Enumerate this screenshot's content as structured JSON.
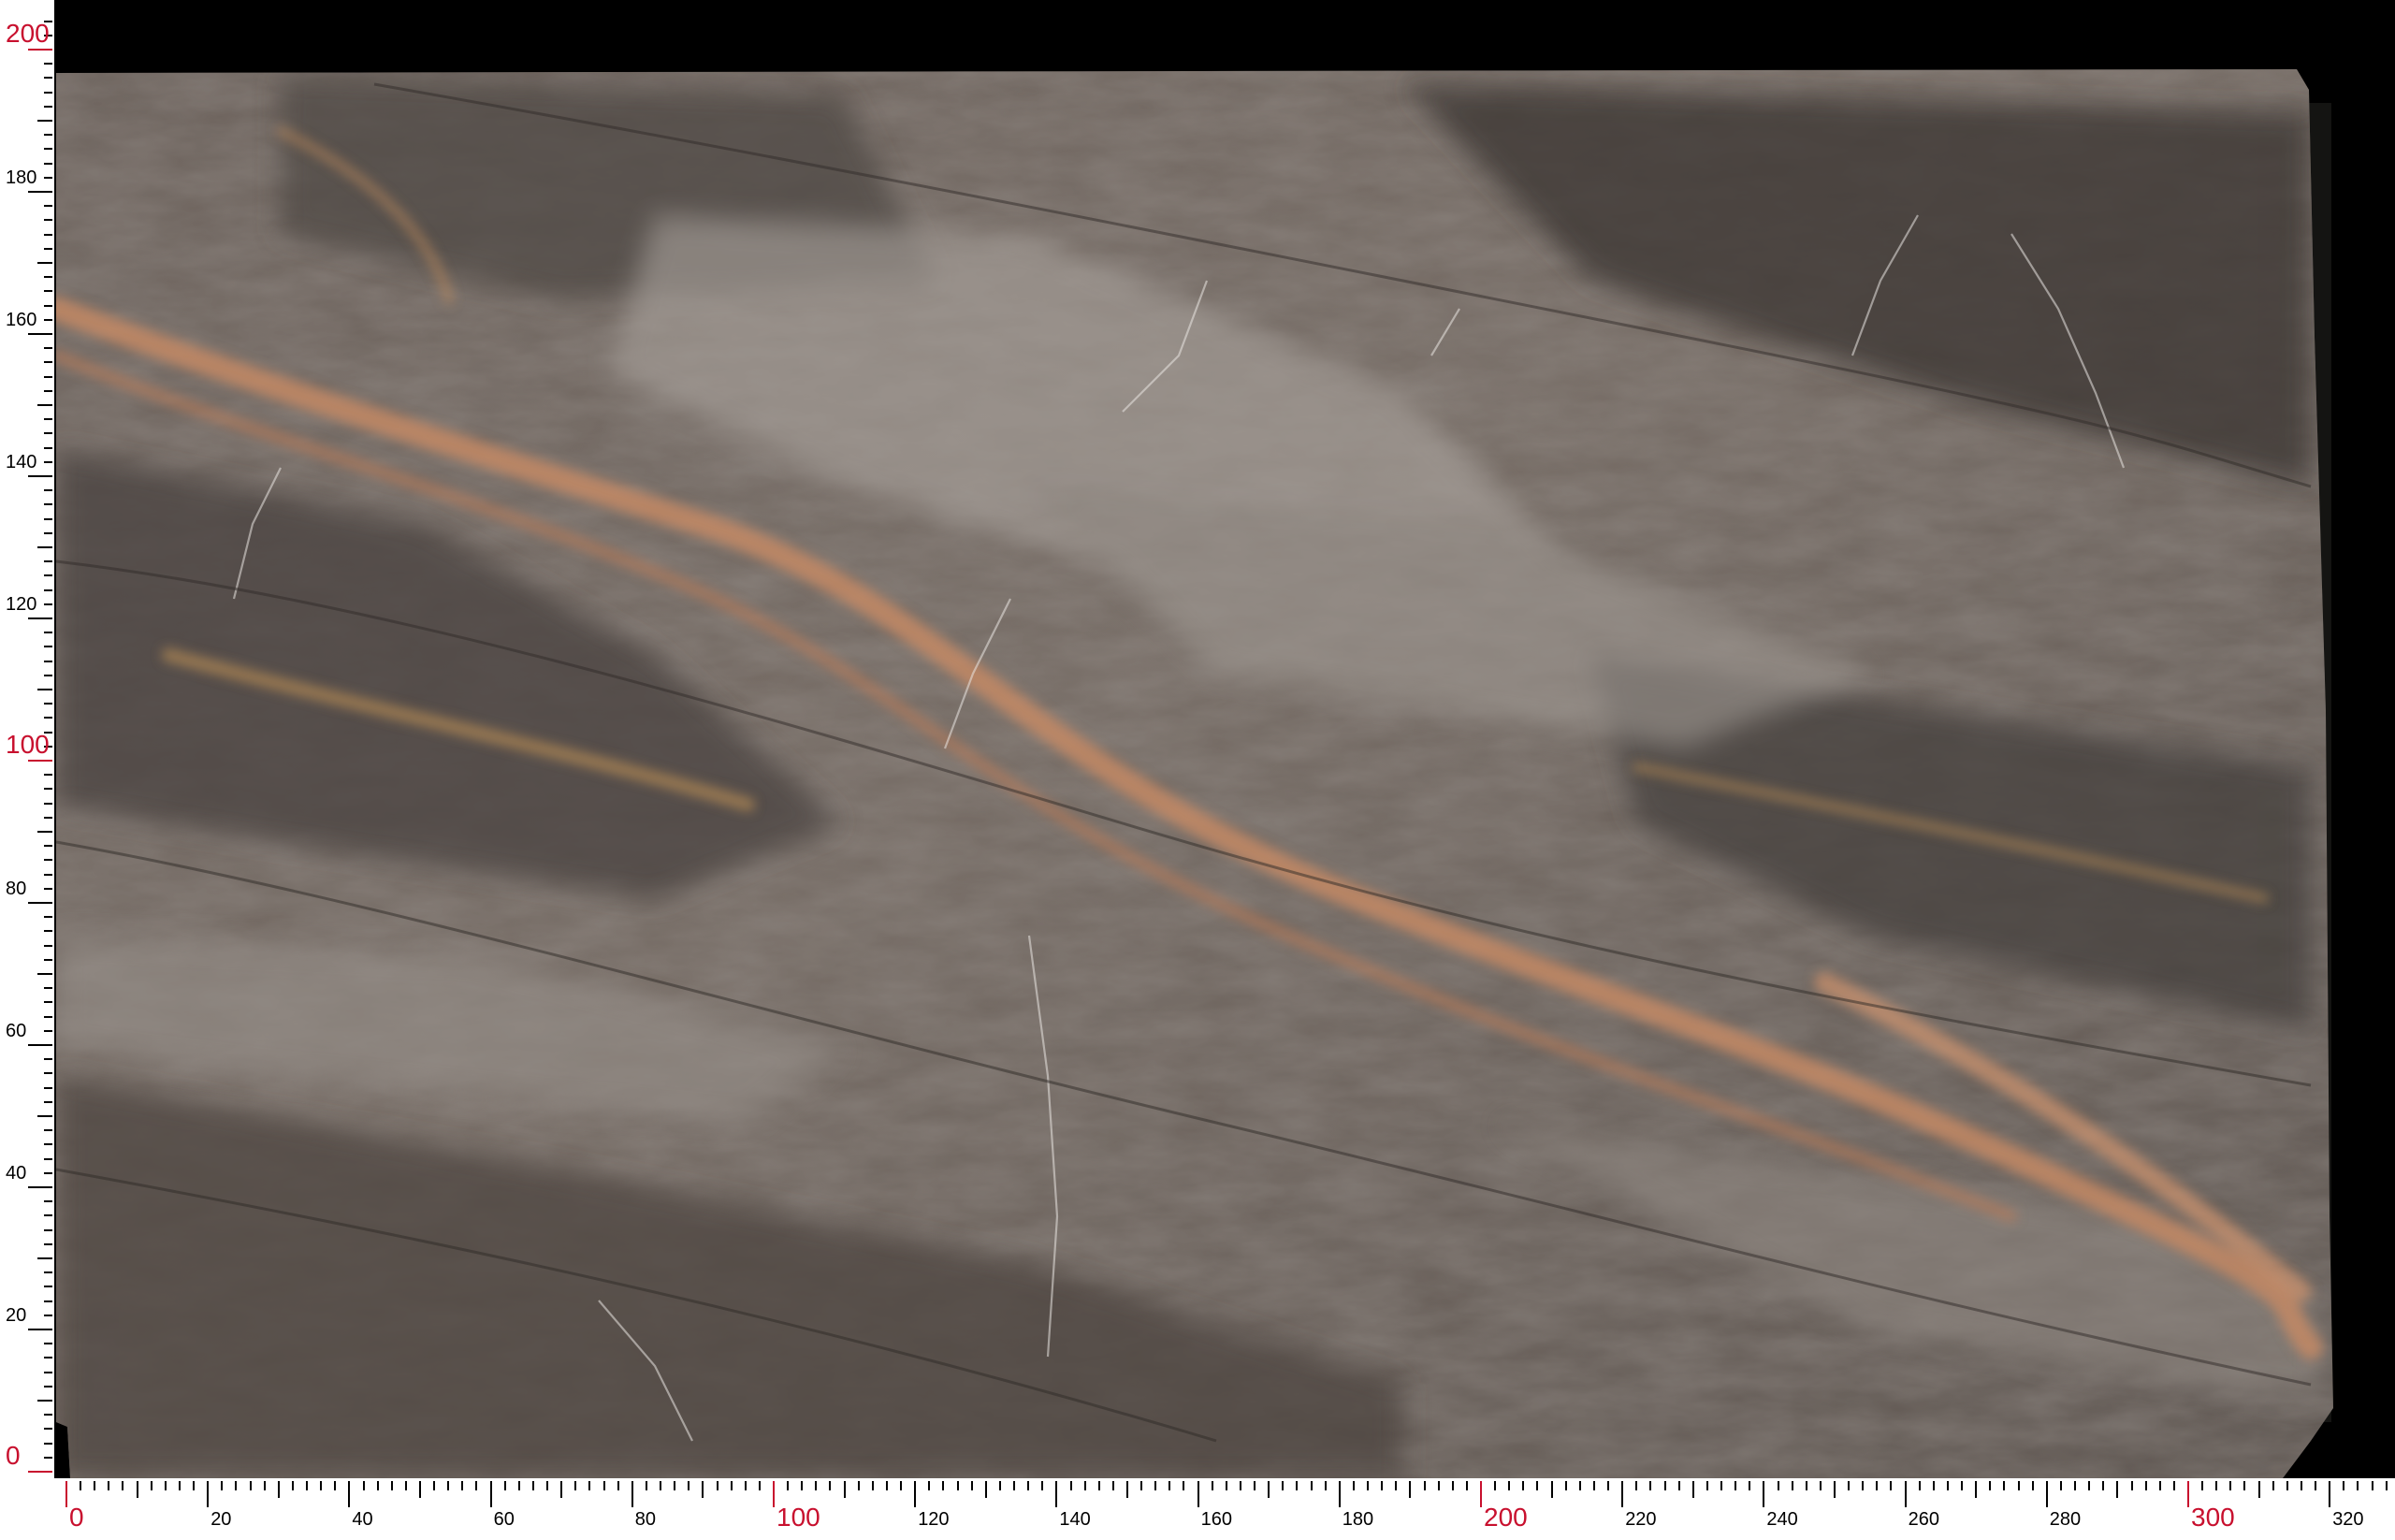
{
  "image": {
    "subject": "marble-slab",
    "colors": {
      "background": "#000000",
      "ruler_background": "#ffffff",
      "major_label": "#c8102e",
      "minor_label": "#000000",
      "stone_base": "#6f6660",
      "stone_dark": "#3a3532",
      "stone_light": "#b9b3ad",
      "vein_orange": "#c08563",
      "vein_gold": "#b58a55"
    }
  },
  "x_ruler": {
    "labels": [
      "0",
      "20",
      "40",
      "60",
      "80",
      "100",
      "120",
      "140",
      "160",
      "180",
      "200",
      "220",
      "240",
      "260",
      "280",
      "300",
      "320"
    ],
    "highlighted": [
      "0",
      "100",
      "200",
      "300"
    ]
  },
  "y_ruler": {
    "labels": [
      "0",
      "20",
      "40",
      "60",
      "80",
      "100",
      "120",
      "140",
      "160",
      "180",
      "200"
    ],
    "highlighted": [
      "0",
      "100",
      "200"
    ]
  }
}
